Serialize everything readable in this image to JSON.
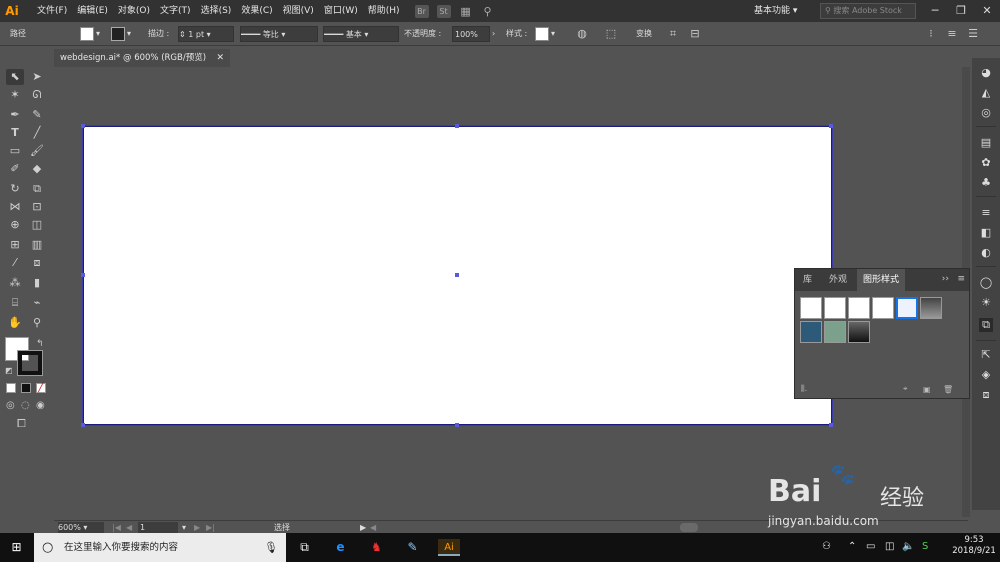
{
  "menubar": {
    "logo": "Ai",
    "items": [
      "文件(F)",
      "编辑(E)",
      "对象(O)",
      "文字(T)",
      "选择(S)",
      "效果(C)",
      "视图(V)",
      "窗口(W)",
      "帮助(H)"
    ],
    "bridge_label": "Br",
    "stock_label": "St",
    "workspace": "基本功能",
    "search_placeholder": "搜索 Adobe Stock"
  },
  "controlbar": {
    "selection_type": "路径",
    "stroke_label": "描边",
    "stroke_weight": "1 pt",
    "profile_label": "等比",
    "brush_label": "基本",
    "opacity_label": "不透明度",
    "opacity_value": "100%",
    "style_label": "样式",
    "transform_label": "变换"
  },
  "document": {
    "tab_title": "webdesign.ai* @ 600% (RGB/预览)"
  },
  "panel": {
    "tabs": [
      "库",
      "外观",
      "图形样式"
    ],
    "active_tab": "图形样式"
  },
  "statusbar": {
    "zoom": "600%",
    "page": "1",
    "tool": "选择"
  },
  "taskbar": {
    "search_placeholder": "在这里输入你要搜索的内容",
    "time": "9:53",
    "date": "2018/9/21"
  },
  "watermark": {
    "brand": "Bai",
    "brand2": "经验",
    "url": "jingyan.baidu.com"
  },
  "colors": {
    "ui_dark": "#323232",
    "ui_mid": "#535353",
    "artboard_border": "#1a1a80",
    "handle": "#5a5adf",
    "ai_orange": "#ff9a00",
    "selection_blue": "#1473e6"
  }
}
